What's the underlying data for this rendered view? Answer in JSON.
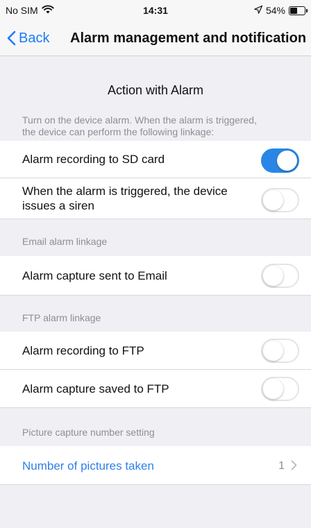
{
  "status_bar": {
    "carrier": "No SIM",
    "time": "14:31",
    "battery_percent": "54%",
    "battery_level": 0.54,
    "icons": [
      "wifi-icon",
      "location-arrow-icon",
      "battery-icon"
    ]
  },
  "nav": {
    "back_label": "Back",
    "title": "Alarm management and notification"
  },
  "action_section": {
    "title": "Action with Alarm",
    "note_line1": "Turn on the device alarm. When the alarm is triggered,",
    "note_line2": "the device can perform the following linkage:",
    "rows": [
      {
        "label": "Alarm recording to SD card",
        "enabled": true
      },
      {
        "label_line1": "When the alarm is triggered, the device",
        "label_line2": "issues a siren",
        "enabled": false
      }
    ]
  },
  "email_section": {
    "label": "Email alarm linkage",
    "rows": [
      {
        "label": "Alarm capture sent to Email",
        "enabled": false
      }
    ]
  },
  "ftp_section": {
    "label": "FTP alarm linkage",
    "rows": [
      {
        "label": "Alarm recording to FTP",
        "enabled": false
      },
      {
        "label": "Alarm capture saved to FTP",
        "enabled": false
      }
    ]
  },
  "picture_section": {
    "label": "Picture capture number setting",
    "row": {
      "label": "Number of pictures taken",
      "value": "1"
    }
  },
  "colors": {
    "accent": "#2a86e6",
    "link": "#2f7fe8",
    "background": "#efeff4",
    "secondary_text": "#8e8e93"
  }
}
